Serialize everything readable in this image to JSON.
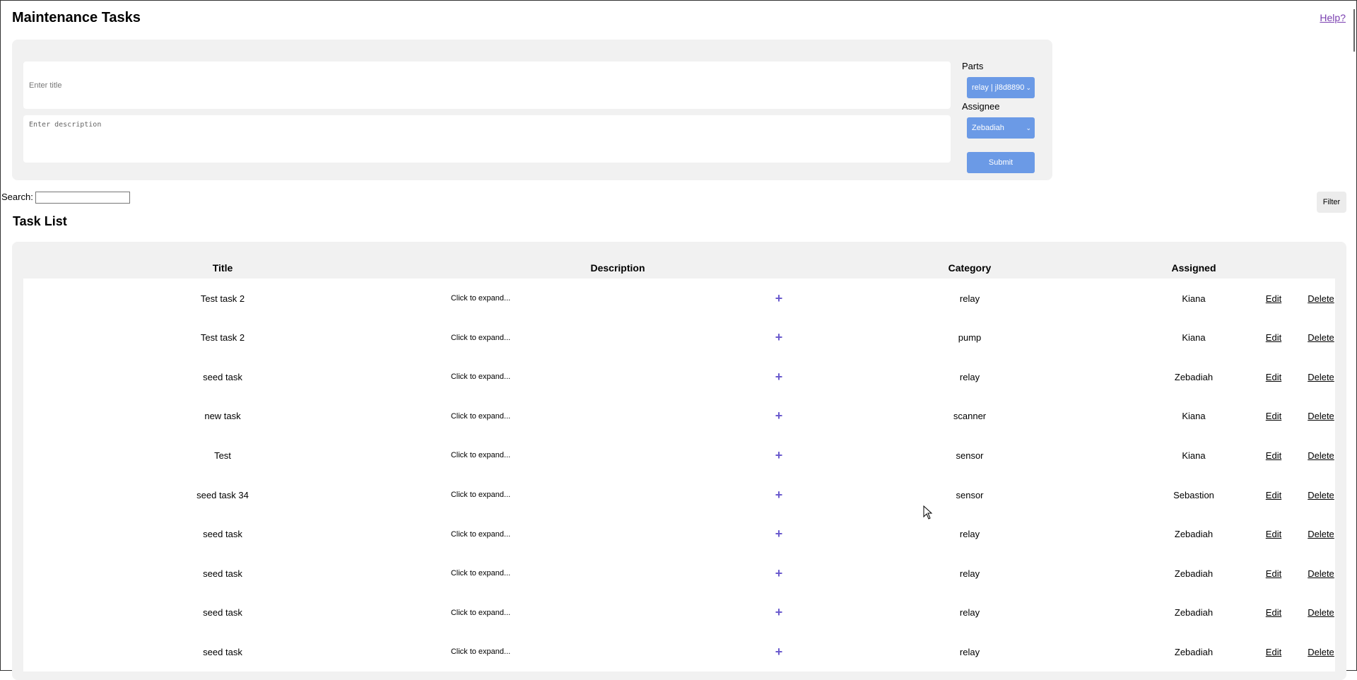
{
  "header": {
    "title": "Maintenance Tasks",
    "help_label": "Help?"
  },
  "form": {
    "title_placeholder": "Enter title",
    "description_placeholder": "Enter description",
    "parts_label": "Parts",
    "parts_selected": "relay | jl8d8890",
    "assignee_label": "Assignee",
    "assignee_selected": "Zebadiah",
    "submit_label": "Submit"
  },
  "search": {
    "label": "Search:",
    "value": ""
  },
  "filter_label": "Filter",
  "list": {
    "title": "Task List",
    "columns": {
      "title": "Title",
      "description": "Description",
      "category": "Category",
      "assigned": "Assigned"
    },
    "rows": [
      {
        "title": "Test task 2",
        "description": "Click to expand...",
        "category": "relay",
        "assigned": "Kiana",
        "edit": "Edit",
        "delete": "Delete"
      },
      {
        "title": "Test task 2",
        "description": "Click to expand...",
        "category": "pump",
        "assigned": "Kiana",
        "edit": "Edit",
        "delete": "Delete"
      },
      {
        "title": "seed task",
        "description": "Click to expand...",
        "category": "relay",
        "assigned": "Zebadiah",
        "edit": "Edit",
        "delete": "Delete"
      },
      {
        "title": "new task",
        "description": "Click to expand...",
        "category": "scanner",
        "assigned": "Kiana",
        "edit": "Edit",
        "delete": "Delete"
      },
      {
        "title": "Test",
        "description": "Click to expand...",
        "category": "sensor",
        "assigned": "Kiana",
        "edit": "Edit",
        "delete": "Delete"
      },
      {
        "title": "seed task 34",
        "description": "Click to expand...",
        "category": "sensor",
        "assigned": "Sebastion",
        "edit": "Edit",
        "delete": "Delete"
      },
      {
        "title": "seed task",
        "description": "Click to expand...",
        "category": "relay",
        "assigned": "Zebadiah",
        "edit": "Edit",
        "delete": "Delete"
      },
      {
        "title": "seed task",
        "description": "Click to expand...",
        "category": "relay",
        "assigned": "Zebadiah",
        "edit": "Edit",
        "delete": "Delete"
      },
      {
        "title": "seed task",
        "description": "Click to expand...",
        "category": "relay",
        "assigned": "Zebadiah",
        "edit": "Edit",
        "delete": "Delete"
      },
      {
        "title": "seed task",
        "description": "Click to expand...",
        "category": "relay",
        "assigned": "Zebadiah",
        "edit": "Edit",
        "delete": "Delete"
      }
    ]
  },
  "icons": {
    "expand": "plus-icon",
    "select": "chevron-down-icon",
    "pointer": "mouse-cursor-icon"
  },
  "colors": {
    "accent": "#6b9ae6",
    "panel": "#f1f1f1",
    "expand_icon": "#6a5acd",
    "help_link": "#7a3fb0"
  }
}
